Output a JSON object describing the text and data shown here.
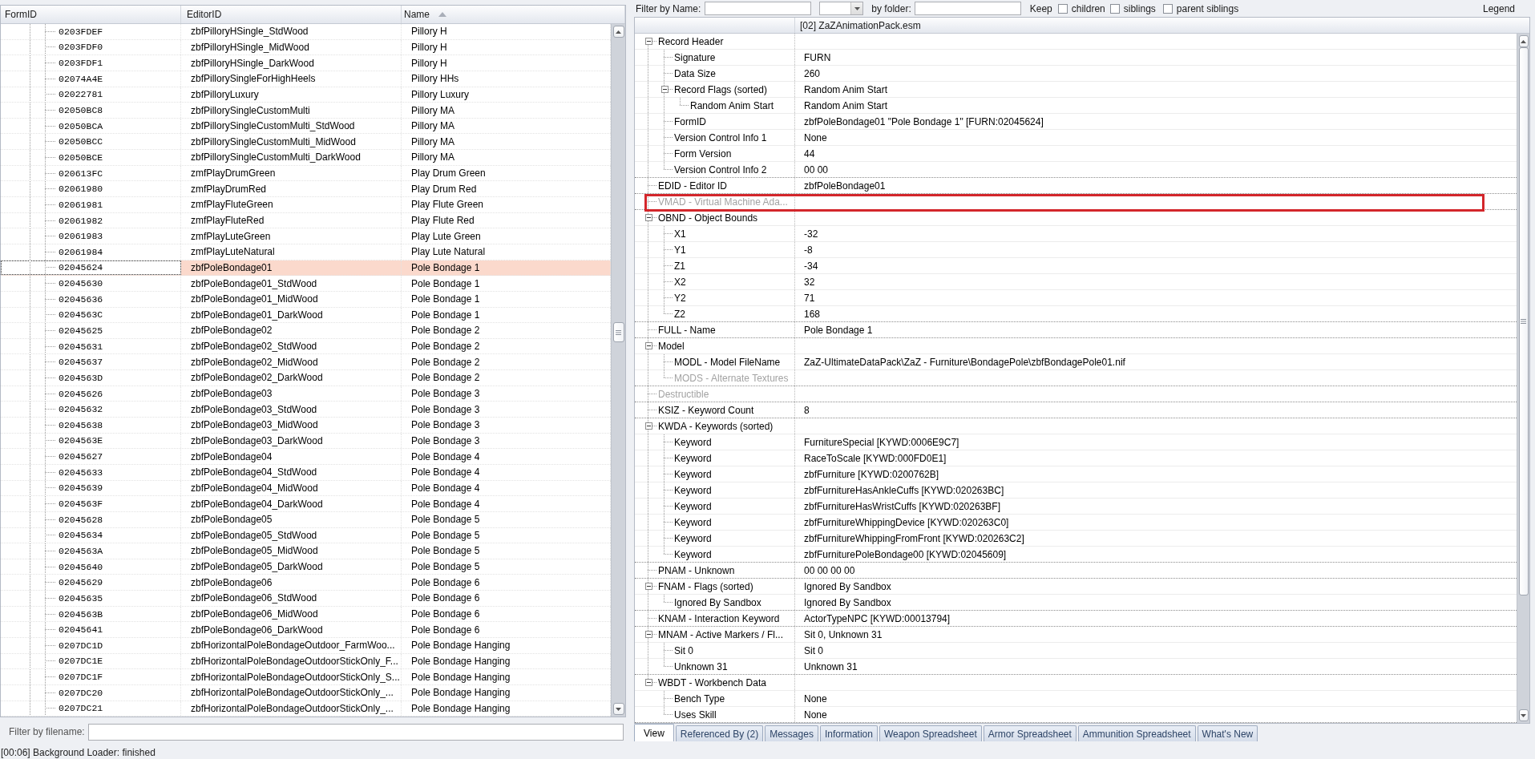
{
  "record_list": {
    "columns": [
      {
        "label": "FormID",
        "sorted": false
      },
      {
        "label": "EditorID",
        "sorted": false
      },
      {
        "label": "Name",
        "sorted": true
      }
    ],
    "rows": [
      {
        "form_id": "0203FDEF",
        "editor_id": "zbfPilloryHSingle_StdWood",
        "name": "Pillory H",
        "selected": false
      },
      {
        "form_id": "0203FDF0",
        "editor_id": "zbfPilloryHSingle_MidWood",
        "name": "Pillory H",
        "selected": false
      },
      {
        "form_id": "0203FDF1",
        "editor_id": "zbfPilloryHSingle_DarkWood",
        "name": "Pillory H",
        "selected": false
      },
      {
        "form_id": "02074A4E",
        "editor_id": "zbfPillorySingleForHighHeels",
        "name": "Pillory HHs",
        "selected": false
      },
      {
        "form_id": "02022781",
        "editor_id": "zbfPilloryLuxury",
        "name": "Pillory Luxury",
        "selected": false
      },
      {
        "form_id": "02050BC8",
        "editor_id": "zbfPillorySingleCustomMulti",
        "name": "Pillory MA",
        "selected": false
      },
      {
        "form_id": "02050BCA",
        "editor_id": "zbfPillorySingleCustomMulti_StdWood",
        "name": "Pillory MA",
        "selected": false
      },
      {
        "form_id": "02050BCC",
        "editor_id": "zbfPillorySingleCustomMulti_MidWood",
        "name": "Pillory MA",
        "selected": false
      },
      {
        "form_id": "02050BCE",
        "editor_id": "zbfPillorySingleCustomMulti_DarkWood",
        "name": "Pillory MA",
        "selected": false
      },
      {
        "form_id": "020613FC",
        "editor_id": "zmfPlayDrumGreen",
        "name": "Play Drum Green",
        "selected": false
      },
      {
        "form_id": "02061980",
        "editor_id": "zmfPlayDrumRed",
        "name": "Play Drum Red",
        "selected": false
      },
      {
        "form_id": "02061981",
        "editor_id": "zmfPlayFluteGreen",
        "name": "Play Flute Green",
        "selected": false
      },
      {
        "form_id": "02061982",
        "editor_id": "zmfPlayFluteRed",
        "name": "Play Flute Red",
        "selected": false
      },
      {
        "form_id": "02061983",
        "editor_id": "zmfPlayLuteGreen",
        "name": "Play Lute Green",
        "selected": false
      },
      {
        "form_id": "02061984",
        "editor_id": "zmfPlayLuteNatural",
        "name": "Play Lute Natural",
        "selected": false
      },
      {
        "form_id": "02045624",
        "editor_id": "zbfPoleBondage01",
        "name": "Pole Bondage 1",
        "selected": true
      },
      {
        "form_id": "02045630",
        "editor_id": "zbfPoleBondage01_StdWood",
        "name": "Pole Bondage 1",
        "selected": false
      },
      {
        "form_id": "02045636",
        "editor_id": "zbfPoleBondage01_MidWood",
        "name": "Pole Bondage 1",
        "selected": false
      },
      {
        "form_id": "0204563C",
        "editor_id": "zbfPoleBondage01_DarkWood",
        "name": "Pole Bondage 1",
        "selected": false
      },
      {
        "form_id": "02045625",
        "editor_id": "zbfPoleBondage02",
        "name": "Pole Bondage 2",
        "selected": false
      },
      {
        "form_id": "02045631",
        "editor_id": "zbfPoleBondage02_StdWood",
        "name": "Pole Bondage 2",
        "selected": false
      },
      {
        "form_id": "02045637",
        "editor_id": "zbfPoleBondage02_MidWood",
        "name": "Pole Bondage 2",
        "selected": false
      },
      {
        "form_id": "0204563D",
        "editor_id": "zbfPoleBondage02_DarkWood",
        "name": "Pole Bondage 2",
        "selected": false
      },
      {
        "form_id": "02045626",
        "editor_id": "zbfPoleBondage03",
        "name": "Pole Bondage 3",
        "selected": false
      },
      {
        "form_id": "02045632",
        "editor_id": "zbfPoleBondage03_StdWood",
        "name": "Pole Bondage 3",
        "selected": false
      },
      {
        "form_id": "02045638",
        "editor_id": "zbfPoleBondage03_MidWood",
        "name": "Pole Bondage 3",
        "selected": false
      },
      {
        "form_id": "0204563E",
        "editor_id": "zbfPoleBondage03_DarkWood",
        "name": "Pole Bondage 3",
        "selected": false
      },
      {
        "form_id": "02045627",
        "editor_id": "zbfPoleBondage04",
        "name": "Pole Bondage 4",
        "selected": false
      },
      {
        "form_id": "02045633",
        "editor_id": "zbfPoleBondage04_StdWood",
        "name": "Pole Bondage 4",
        "selected": false
      },
      {
        "form_id": "02045639",
        "editor_id": "zbfPoleBondage04_MidWood",
        "name": "Pole Bondage 4",
        "selected": false
      },
      {
        "form_id": "0204563F",
        "editor_id": "zbfPoleBondage04_DarkWood",
        "name": "Pole Bondage 4",
        "selected": false
      },
      {
        "form_id": "02045628",
        "editor_id": "zbfPoleBondage05",
        "name": "Pole Bondage 5",
        "selected": false
      },
      {
        "form_id": "02045634",
        "editor_id": "zbfPoleBondage05_StdWood",
        "name": "Pole Bondage 5",
        "selected": false
      },
      {
        "form_id": "0204563A",
        "editor_id": "zbfPoleBondage05_MidWood",
        "name": "Pole Bondage 5",
        "selected": false
      },
      {
        "form_id": "02045640",
        "editor_id": "zbfPoleBondage05_DarkWood",
        "name": "Pole Bondage 5",
        "selected": false
      },
      {
        "form_id": "02045629",
        "editor_id": "zbfPoleBondage06",
        "name": "Pole Bondage 6",
        "selected": false
      },
      {
        "form_id": "02045635",
        "editor_id": "zbfPoleBondage06_StdWood",
        "name": "Pole Bondage 6",
        "selected": false
      },
      {
        "form_id": "0204563B",
        "editor_id": "zbfPoleBondage06_MidWood",
        "name": "Pole Bondage 6",
        "selected": false
      },
      {
        "form_id": "02045641",
        "editor_id": "zbfPoleBondage06_DarkWood",
        "name": "Pole Bondage 6",
        "selected": false
      },
      {
        "form_id": "0207DC1D",
        "editor_id": "zbfHorizontalPoleBondageOutdoor_FarmWoo...",
        "name": "Pole Bondage Hanging",
        "selected": false
      },
      {
        "form_id": "0207DC1E",
        "editor_id": "zbfHorizontalPoleBondageOutdoorStickOnly_F...",
        "name": "Pole Bondage Hanging",
        "selected": false
      },
      {
        "form_id": "0207DC1F",
        "editor_id": "zbfHorizontalPoleBondageOutdoorStickOnly_S...",
        "name": "Pole Bondage Hanging",
        "selected": false
      },
      {
        "form_id": "0207DC20",
        "editor_id": "zbfHorizontalPoleBondageOutdoorStickOnly_...",
        "name": "Pole Bondage Hanging",
        "selected": false
      },
      {
        "form_id": "0207DC21",
        "editor_id": "zbfHorizontalPoleBondageOutdoorStickOnly_...",
        "name": "Pole Bondage Hanging",
        "selected": false
      }
    ]
  },
  "file_filter": {
    "label": "Filter by filename:"
  },
  "record_view": {
    "toolbar": {
      "name_filter_label": "Filter by Name:",
      "folder_filter_label": "by folder:",
      "keep_label": "Keep",
      "options": [
        {
          "label": "children",
          "checked": false
        },
        {
          "label": "siblings",
          "checked": false
        },
        {
          "label": "parent siblings",
          "checked": false
        }
      ],
      "legend_button": "Legend"
    },
    "header": "[02] ZaZAnimationPack.esm",
    "tree": [
      {
        "label": "Record Header",
        "disabled": false,
        "outlined": false,
        "expanded": true,
        "children": [
          {
            "label": "Signature",
            "value": "FURN",
            "disabled": false,
            "outlined": false
          },
          {
            "label": "Data Size",
            "value": "260",
            "disabled": false,
            "outlined": false
          },
          {
            "label": "Record Flags (sorted)",
            "value": "Random Anim Start",
            "disabled": false,
            "outlined": false,
            "expanded": true,
            "children": [
              {
                "label": "Random Anim Start",
                "value": "Random Anim Start",
                "disabled": false,
                "outlined": false
              }
            ]
          },
          {
            "label": "FormID",
            "value": "zbfPoleBondage01 \"Pole Bondage 1\" [FURN:02045624]",
            "disabled": false,
            "outlined": false
          },
          {
            "label": "Version Control Info 1",
            "value": "None",
            "disabled": false,
            "outlined": false
          },
          {
            "label": "Form Version",
            "value": "44",
            "disabled": false,
            "outlined": false
          },
          {
            "label": "Version Control Info 2",
            "value": "00 00",
            "disabled": false,
            "outlined": false
          }
        ]
      },
      {
        "label": "EDID - Editor ID",
        "value": "zbfPoleBondage01",
        "disabled": false,
        "outlined": false
      },
      {
        "label": "VMAD - Virtual Machine Ada...",
        "disabled": true,
        "outlined": true
      },
      {
        "label": "OBND - Object Bounds",
        "disabled": false,
        "outlined": false,
        "expanded": true,
        "children": [
          {
            "label": "X1",
            "value": "-32",
            "disabled": false,
            "outlined": false
          },
          {
            "label": "Y1",
            "value": "-8",
            "disabled": false,
            "outlined": false
          },
          {
            "label": "Z1",
            "value": "-34",
            "disabled": false,
            "outlined": false
          },
          {
            "label": "X2",
            "value": "32",
            "disabled": false,
            "outlined": false
          },
          {
            "label": "Y2",
            "value": "71",
            "disabled": false,
            "outlined": false
          },
          {
            "label": "Z2",
            "value": "168",
            "disabled": false,
            "outlined": false
          }
        ]
      },
      {
        "label": "FULL - Name",
        "value": "Pole Bondage 1",
        "disabled": false,
        "outlined": false
      },
      {
        "label": "Model",
        "disabled": false,
        "outlined": false,
        "expanded": true,
        "children": [
          {
            "label": "MODL - Model FileName",
            "value": "ZaZ-UltimateDataPack\\ZaZ - Furniture\\BondagePole\\zbfBondagePole01.nif",
            "disabled": false,
            "outlined": false
          },
          {
            "label": "MODS - Alternate Textures",
            "disabled": true,
            "outlined": false
          }
        ]
      },
      {
        "label": "Destructible",
        "disabled": true,
        "outlined": false
      },
      {
        "label": "KSIZ - Keyword Count",
        "value": "8",
        "disabled": false,
        "outlined": false
      },
      {
        "label": "KWDA - Keywords (sorted)",
        "disabled": false,
        "outlined": false,
        "expanded": true,
        "children": [
          {
            "label": "Keyword",
            "value": "FurnitureSpecial [KYWD:0006E9C7]",
            "disabled": false,
            "outlined": false
          },
          {
            "label": "Keyword",
            "value": "RaceToScale [KYWD:000FD0E1]",
            "disabled": false,
            "outlined": false
          },
          {
            "label": "Keyword",
            "value": "zbfFurniture [KYWD:0200762B]",
            "disabled": false,
            "outlined": false
          },
          {
            "label": "Keyword",
            "value": "zbfFurnitureHasAnkleCuffs [KYWD:020263BC]",
            "disabled": false,
            "outlined": false
          },
          {
            "label": "Keyword",
            "value": "zbfFurnitureHasWristCuffs [KYWD:020263BF]",
            "disabled": false,
            "outlined": false
          },
          {
            "label": "Keyword",
            "value": "zbfFurnitureWhippingDevice [KYWD:020263C0]",
            "disabled": false,
            "outlined": false
          },
          {
            "label": "Keyword",
            "value": "zbfFurnitureWhippingFromFront [KYWD:020263C2]",
            "disabled": false,
            "outlined": false
          },
          {
            "label": "Keyword",
            "value": "zbfFurniturePoleBondage00 [KYWD:02045609]",
            "disabled": false,
            "outlined": false
          }
        ]
      },
      {
        "label": "PNAM - Unknown",
        "value": "00 00 00 00",
        "disabled": false,
        "outlined": false
      },
      {
        "label": "FNAM - Flags (sorted)",
        "value": "Ignored By Sandbox",
        "disabled": false,
        "outlined": false,
        "expanded": true,
        "children": [
          {
            "label": "Ignored By Sandbox",
            "value": "Ignored By Sandbox",
            "disabled": false,
            "outlined": false
          }
        ]
      },
      {
        "label": "KNAM - Interaction Keyword",
        "value": "ActorTypeNPC [KYWD:00013794]",
        "disabled": false,
        "outlined": false
      },
      {
        "label": "MNAM - Active Markers / Fl...",
        "value": "Sit 0, Unknown 31",
        "disabled": false,
        "outlined": false,
        "expanded": true,
        "children": [
          {
            "label": "Sit 0",
            "value": "Sit 0",
            "disabled": false,
            "outlined": false
          },
          {
            "label": "Unknown 31",
            "value": "Unknown 31",
            "disabled": false,
            "outlined": false
          }
        ]
      },
      {
        "label": "WBDT - Workbench Data",
        "disabled": false,
        "outlined": false,
        "expanded": true,
        "children": [
          {
            "label": "Bench Type",
            "value": "None",
            "disabled": false,
            "outlined": false
          },
          {
            "label": "Uses Skill",
            "value": "None",
            "disabled": false,
            "outlined": false
          }
        ]
      }
    ]
  },
  "tabs": [
    {
      "label": "View",
      "selected": true
    },
    {
      "label": "Referenced By (2)",
      "selected": false
    },
    {
      "label": "Messages",
      "selected": false
    },
    {
      "label": "Information",
      "selected": false
    },
    {
      "label": "Weapon Spreadsheet",
      "selected": false
    },
    {
      "label": "Armor Spreadsheet",
      "selected": false
    },
    {
      "label": "Ammunition Spreadsheet",
      "selected": false
    },
    {
      "label": "What's New",
      "selected": false
    }
  ],
  "status_bar": {
    "text": "[00:06] Background Loader: finished"
  }
}
